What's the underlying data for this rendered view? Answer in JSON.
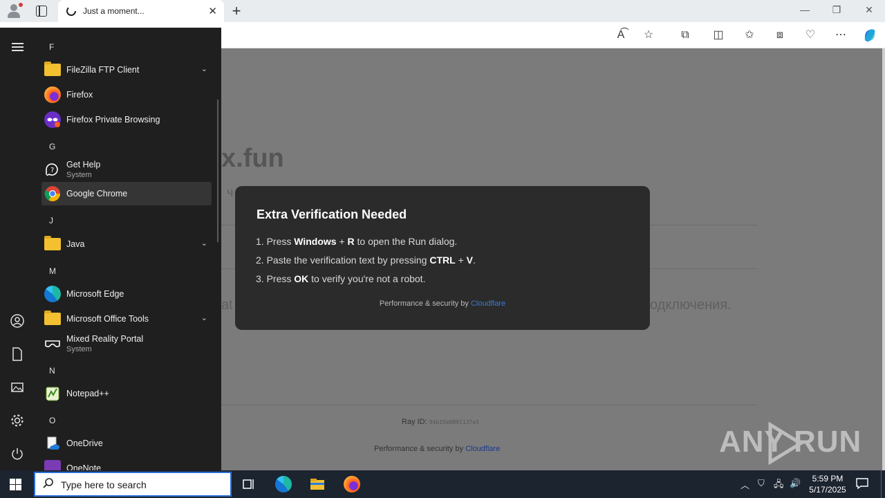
{
  "browser": {
    "tab_title": "Just a moment...",
    "new_tab_symbol": "+",
    "tab_close_symbol": "✕",
    "window_controls": [
      "—",
      "❐",
      "✕"
    ]
  },
  "page": {
    "site_title_partial": "x.fun",
    "site_subtitle_partial": "ч",
    "bg_text_left": "at",
    "bg_text_right": "одключения.",
    "ray_label": "Ray ID:",
    "ray_value": "94b15e8891137e5",
    "perf_prefix": "Performance & security by ",
    "perf_link": "Cloudflare"
  },
  "watermark": {
    "left": "ANY",
    "right": "RUN"
  },
  "modal": {
    "title": "Extra Verification Needed",
    "step1": {
      "a": "1. Press ",
      "b1": "Windows",
      "c": " + ",
      "b2": "R",
      "d": " to open the Run dialog."
    },
    "step2": {
      "a": "2. Paste the verification text by pressing ",
      "b1": "CTRL",
      "c": " + ",
      "b2": "V",
      "d": "."
    },
    "step3": {
      "a": "3. Press ",
      "b1": "OK",
      "d": " to verify you're not a robot."
    },
    "perf_prefix": "Performance & security by ",
    "perf_link": "Cloudflare"
  },
  "startmenu": {
    "letters": {
      "f": "F",
      "g": "G",
      "j": "J",
      "m": "M",
      "n": "N",
      "o": "O"
    },
    "apps": {
      "filezilla": "FileZilla FTP Client",
      "firefox": "Firefox",
      "firefox_private": "Firefox Private Browsing",
      "get_help": "Get Help",
      "get_help_sub": "System",
      "chrome": "Google Chrome",
      "java": "Java",
      "edge": "Microsoft Edge",
      "office_tools": "Microsoft Office Tools",
      "mixed_reality": "Mixed Reality Portal",
      "mixed_reality_sub": "System",
      "notepadpp": "Notepad++",
      "onedrive": "OneDrive",
      "onenote": "OneNote"
    }
  },
  "taskbar": {
    "search_placeholder": "Type here to search",
    "time": "5:59 PM",
    "date": "5/17/2025"
  },
  "colors": {
    "modal_bg": "#2b2b2b",
    "start_bg": "#1f1f1f",
    "taskbar_bg": "#1c2430",
    "link": "#3a7bd5"
  }
}
